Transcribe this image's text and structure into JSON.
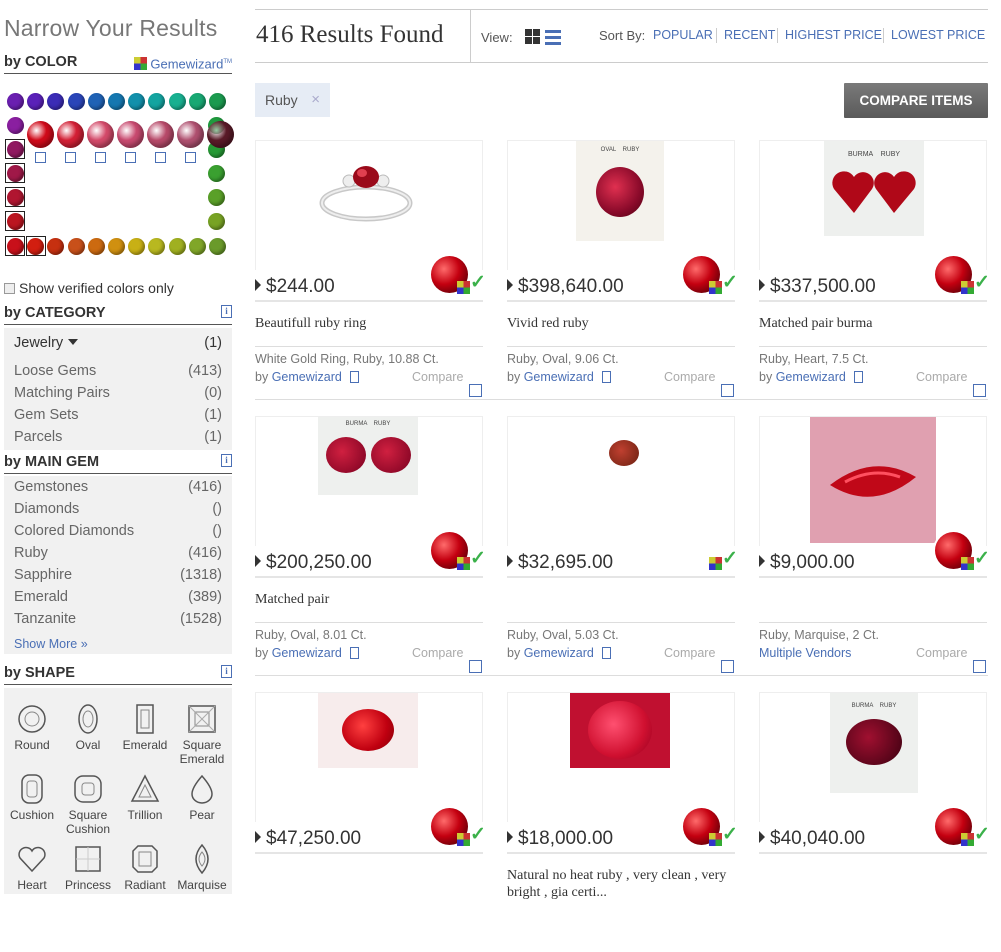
{
  "sidebar": {
    "title": "Narrow Your Results",
    "color_heading": "by COLOR",
    "brand": "Gemewizard",
    "brand_tm": "TM",
    "show_verified": "Show verified colors only",
    "category_heading": "by CATEGORY",
    "categories": [
      {
        "label": "Jewelry",
        "count": "(1)"
      },
      {
        "label": "Loose Gems",
        "count": "(413)"
      },
      {
        "label": "Matching Pairs",
        "count": "(0)"
      },
      {
        "label": "Gem Sets",
        "count": "(1)"
      },
      {
        "label": "Parcels",
        "count": "(1)"
      }
    ],
    "main_gem_heading": "by MAIN GEM",
    "main_gems": [
      {
        "label": "Gemstones",
        "count": "(416)"
      },
      {
        "label": "Diamonds",
        "count": "()"
      },
      {
        "label": "Colored Diamonds",
        "count": "()"
      },
      {
        "label": "Ruby",
        "count": "(416)"
      },
      {
        "label": "Sapphire",
        "count": "(1318)"
      },
      {
        "label": "Emerald",
        "count": "(389)"
      },
      {
        "label": "Tanzanite",
        "count": "(1528)"
      }
    ],
    "show_more": "Show More »",
    "shape_heading": "by SHAPE",
    "shapes": [
      "Round",
      "Oval",
      "Emerald",
      "Square Emerald",
      "Cushion",
      "Square Cushion",
      "Trillion",
      "Pear",
      "Heart",
      "Princess",
      "Radiant",
      "Marquise"
    ],
    "info_glyph": "i"
  },
  "header": {
    "results": "416 Results Found",
    "view_label": "View:",
    "sort_label": "Sort By:",
    "sort_options": [
      "POPULAR",
      "RECENT",
      "HIGHEST PRICE",
      "LOWEST PRICE"
    ]
  },
  "filter_tag": {
    "label": "Ruby",
    "remove": "×"
  },
  "compare_button": "COMPARE ITEMS",
  "products": [
    {
      "price": "$244.00",
      "name": "Beautifull ruby ring",
      "desc": "White Gold Ring, Ruby, 10.88 Ct.",
      "vendor_prefix": "by",
      "vendor": "Gemewizard",
      "compare": "Compare"
    },
    {
      "price": "$398,640.00",
      "name": "Vivid red ruby",
      "desc": "Ruby, Oval, 9.06 Ct.",
      "vendor_prefix": "by",
      "vendor": "Gemewizard",
      "compare": "Compare"
    },
    {
      "price": "$337,500.00",
      "name": "Matched pair burma",
      "desc": "Ruby, Heart, 7.5 Ct.",
      "vendor_prefix": "by",
      "vendor": "Gemewizard",
      "compare": "Compare"
    },
    {
      "price": "$200,250.00",
      "name": "Matched pair",
      "desc": "Ruby, Oval, 8.01 Ct.",
      "vendor_prefix": "by",
      "vendor": "Gemewizard",
      "compare": "Compare"
    },
    {
      "price": "$32,695.00",
      "name": "",
      "desc": "Ruby, Oval, 5.03 Ct.",
      "vendor_prefix": "by",
      "vendor": "Gemewizard",
      "compare": "Compare"
    },
    {
      "price": "$9,000.00",
      "name": "",
      "desc": "Ruby, Marquise, 2 Ct.",
      "vendor_prefix": "",
      "vendor": "Multiple Vendors",
      "compare": "Compare"
    },
    {
      "price": "$47,250.00",
      "name": "",
      "desc": "",
      "vendor_prefix": "",
      "vendor": "",
      "compare": ""
    },
    {
      "price": "$18,000.00",
      "name": "Natural no heat ruby , very clean , very bright , gia certi...",
      "desc": "",
      "vendor_prefix": "",
      "vendor": "",
      "compare": ""
    },
    {
      "price": "$40,040.00",
      "name": "",
      "desc": "",
      "vendor_prefix": "",
      "vendor": "",
      "compare": ""
    }
  ],
  "image_labels": {
    "oval_ruby": "OVAL    RUBY",
    "burma_ruby": "BURMA    RUBY"
  }
}
